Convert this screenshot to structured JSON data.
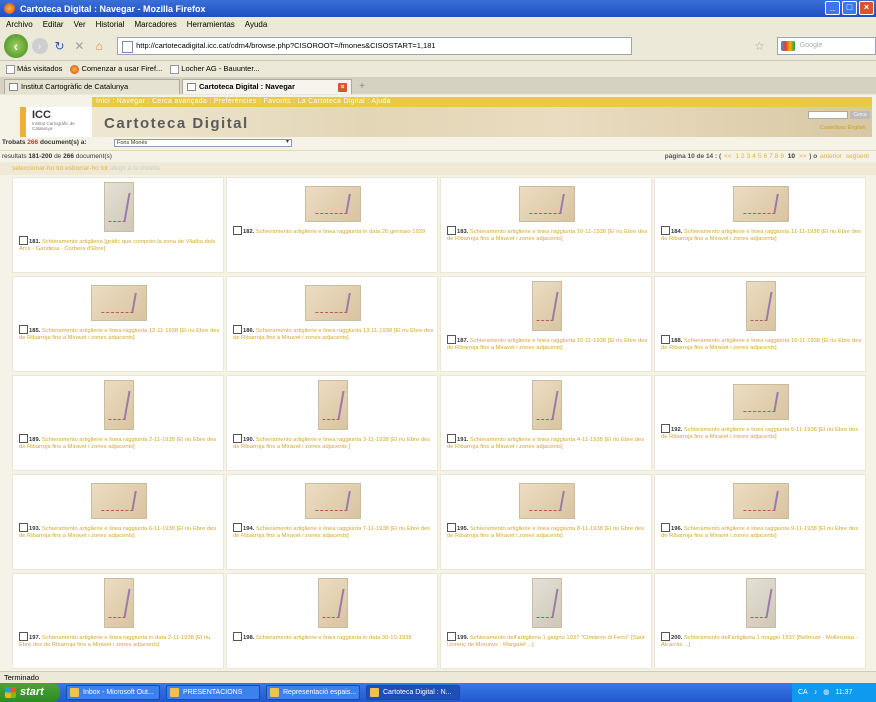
{
  "window": {
    "title": "Cartoteca Digital : Navegar - Mozilla Firefox"
  },
  "menu": [
    "Archivo",
    "Editar",
    "Ver",
    "Historial",
    "Marcadores",
    "Herramientas",
    "Ayuda"
  ],
  "nav": {
    "url": "http://cartotecadigital.icc.cat/cdm4/browse.php?CISOROOT=/fmones&CISOSTART=1,181",
    "search_placeholder": "Google"
  },
  "bookmarks": [
    "Más visitados",
    "Comenzar a usar Firef...",
    "Locher AG - Bauunter..."
  ],
  "tabs": [
    {
      "label": "Institut Cartogràfic de Catalunya",
      "active": false
    },
    {
      "label": "Cartoteca Digital : Navegar",
      "active": true
    }
  ],
  "site": {
    "nav": "Inici : Navegar : Cerca avançada : Preferències : Favorits : La Cartoteca Digital : Ajuda",
    "logo": "ICC",
    "logo_sub": "Institut Cartogràfic de Catalunya",
    "title": "Cartoteca Digital",
    "header_button": "Cerca",
    "languages": "Castellano English"
  },
  "found": {
    "prefix": "Trobats",
    "count": "266",
    "suffix": "document(s) a:",
    "collection": "Fons Monès"
  },
  "results": {
    "label_pre": "resultats",
    "range": "181-200",
    "label_mid": "de",
    "total": "266",
    "label_post": "document(s)",
    "pager_label": "pàgina 10 de 14 : (",
    "prev": "<<",
    "pages": [
      "1",
      "2",
      "3",
      "4",
      "5",
      "6",
      "7",
      "8",
      "9"
    ],
    "current": "10",
    "next": ">>",
    "pager_tail": ") o",
    "prev_link": "anterior",
    "next_link": "següent"
  },
  "selection": {
    "select_all": "seleccionar-ho tot",
    "unselect_all": "esborrar-ho tot",
    "disabled": "afegir a la cistella"
  },
  "items": [
    {
      "num": "181.",
      "title": "Schieramento artiglieria [gràfic que comprèn la zona de Vilalba dels Arcs - Gandesa - Corbera d'Ebre]",
      "shape": "port",
      "grey": true
    },
    {
      "num": "182.",
      "title": "Schieramento artiglierie e linea raggiunta in data 26 gennaio 1939",
      "shape": "land",
      "grey": false
    },
    {
      "num": "183.",
      "title": "Schieramento artiglierie e linea raggiunta 10-11-1938 [El riu Ebre des de Ribarroja fins a Miravet i zones adjacents]",
      "shape": "land",
      "grey": false
    },
    {
      "num": "184.",
      "title": "Schieramento artiglierie e linea raggiunta 11-11-1938 [El riu Ebre des de Ribarroja fins a Miravet i zones adjacents]",
      "shape": "land",
      "grey": false
    },
    {
      "num": "185.",
      "title": "Schieramento artiglierie e linea raggiunta 12-11-1938 [El riu Ebre des de Ribarroja fins a Miravet i zones adjacents]",
      "shape": "land",
      "grey": false
    },
    {
      "num": "186.",
      "title": "Schieramento artiglierie e linea raggiunta 13-11-1938 [El riu Ebre des de Ribarroja fins a Miravet i zones adjacents]",
      "shape": "land",
      "grey": false
    },
    {
      "num": "187.",
      "title": "Schieramento artiglierie e linea raggiunta 15-11-1938 [El riu Ebre des de Ribarroja fins a Miravet i zones adjacents]",
      "shape": "port",
      "grey": false
    },
    {
      "num": "188.",
      "title": "Schieramento artiglierie e linea raggiunta 16-11-1938 [El riu Ebre des de Ribarroja fins a Miravet i zones adjacents]",
      "shape": "port",
      "grey": false
    },
    {
      "num": "189.",
      "title": "Schieramento artiglierie e linea raggiunta 2-11-1938 [El riu Ebre des de Ribarroja fins a Miravet i zones adjacents]",
      "shape": "port",
      "grey": false
    },
    {
      "num": "190.",
      "title": "Schieramento artiglierie e linea raggiunta 3-11-1938 [El riu Ebre des de Ribarroja fins a Miravet i zones adjacents ]",
      "shape": "port",
      "grey": false
    },
    {
      "num": "191.",
      "title": "Schieramento artiglierie e linea raggiunta 4-11-1938 [El riu Ebre des de Ribarroja fins a Miravet i zones adjacents]",
      "shape": "port",
      "grey": false
    },
    {
      "num": "192.",
      "title": "Schieramento artiglierie e linea raggiunta 5-11-1938 [El riu Ebre des de Ribarroja fins a Miravet i zones adjacents]",
      "shape": "land",
      "grey": false
    },
    {
      "num": "193.",
      "title": "Schieramento artiglierie e linea raggiunta 6-11-1938 [El riu Ebre des de Ribarroja fins a Miravet i zones adjacents]",
      "shape": "land",
      "grey": false
    },
    {
      "num": "194.",
      "title": "Schieramento artiglierie e linea raggiunta 7-11-1938 [El riu Ebre des de Ribarroja fins a Miravet i zones adjacents]",
      "shape": "land",
      "grey": false
    },
    {
      "num": "195.",
      "title": "Schieramento artiglierie e linea raggiunta 8-11-1938 [El riu Ebre des de Ribarroja fins a Miravet i zones adjacents]",
      "shape": "land",
      "grey": false
    },
    {
      "num": "196.",
      "title": "Schieramento artiglierie e linea raggiunta 9-11-1938 [El riu Ebre des de Ribarroja fins a Miravet i zones adjacents]",
      "shape": "land",
      "grey": false
    },
    {
      "num": "197.",
      "title": "Schieramento artiglierie e linea raggiunta in data 2-11-1938 [El riu Ebre des de Ribarroja fins a Miravet i zones adjacents]",
      "shape": "port",
      "grey": false
    },
    {
      "num": "198.",
      "title": "Schieramento artiglierie e linea raggiunta in data 30-10-1938",
      "shape": "port",
      "grey": false
    },
    {
      "num": "199.",
      "title": "Schieramento dell'artiglieria 1 giugno 1937 \"Cimiteire di Ferro\" [Sant Llorenç de Morunys - Margalef ...]",
      "shape": "port",
      "grey": true
    },
    {
      "num": "200.",
      "title": "Schieramento dell'artiglieria 1 maggio 1937 [Bellmunt - Mollerussa - Alcarràs ...]",
      "shape": "port",
      "grey": true
    }
  ],
  "status": "Terminado",
  "taskbar": {
    "start": "start",
    "tasks": [
      "Inbox - Microsoft Out...",
      "PRESENTACIONS",
      "Representació espais...",
      "Cartoteca Digital : N..."
    ],
    "tray_lang": "CA",
    "clock": "11:37"
  }
}
